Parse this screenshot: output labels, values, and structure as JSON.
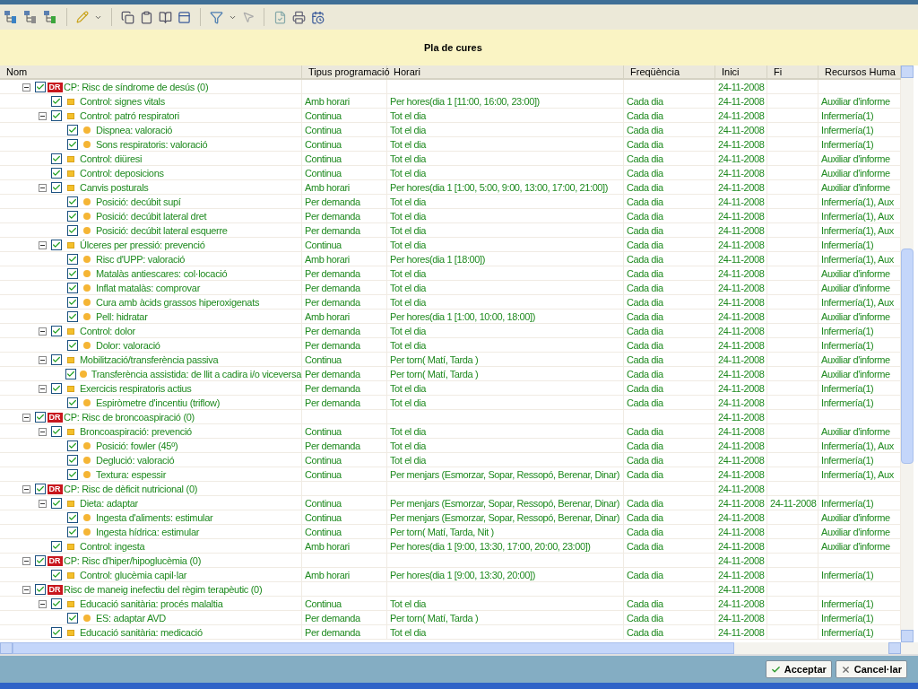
{
  "banner": {
    "title": "Pla de cures"
  },
  "table": {
    "columns": [
      "Nom",
      "Tipus programació",
      "Horari",
      "Freqüència",
      "Inici",
      "Fi",
      "Recursos Huma"
    ],
    "rows": [
      {
        "kind": "diagnosis",
        "badge": "DR",
        "name": "CP: Risc de síndrome de desús (0)",
        "checked": true,
        "expanded": true,
        "start": "24-11-2008",
        "children": [
          {
            "kind": "activity",
            "name": "Control: signes vitals",
            "checked": true,
            "schedule_type": "Amb horari",
            "schedule": "Per hores(dia 1 [11:00, 16:00, 23:00])",
            "frequency": "Cada dia",
            "start": "24-11-2008",
            "resources": "Auxiliar d'informe"
          },
          {
            "kind": "activity",
            "name": "Control: patró respiratori",
            "checked": true,
            "expanded": true,
            "schedule_type": "Continua",
            "schedule": "Tot el dia",
            "frequency": "Cada dia",
            "start": "24-11-2008",
            "resources": "Infermería(1)",
            "children": [
              {
                "kind": "task",
                "name": "Dispnea: valoració",
                "checked": true,
                "schedule_type": "Continua",
                "schedule": "Tot el dia",
                "frequency": "Cada dia",
                "start": "24-11-2008",
                "resources": "Infermería(1)"
              },
              {
                "kind": "task",
                "name": "Sons respiratoris: valoració",
                "checked": true,
                "schedule_type": "Continua",
                "schedule": "Tot el dia",
                "frequency": "Cada dia",
                "start": "24-11-2008",
                "resources": "Infermería(1)"
              }
            ]
          },
          {
            "kind": "activity",
            "name": "Control: diüresi",
            "checked": true,
            "schedule_type": "Continua",
            "schedule": "Tot el dia",
            "frequency": "Cada dia",
            "start": "24-11-2008",
            "resources": "Auxiliar d'informe"
          },
          {
            "kind": "activity",
            "name": "Control: deposicions",
            "checked": true,
            "schedule_type": "Continua",
            "schedule": "Tot el dia",
            "frequency": "Cada dia",
            "start": "24-11-2008",
            "resources": "Auxiliar d'informe"
          },
          {
            "kind": "activity",
            "name": "Canvis posturals",
            "checked": true,
            "expanded": true,
            "schedule_type": "Amb horari",
            "schedule": "Per hores(dia 1 [1:00, 5:00, 9:00, 13:00, 17:00, 21:00])",
            "frequency": "Cada dia",
            "start": "24-11-2008",
            "resources": "Auxiliar d'informe",
            "children": [
              {
                "kind": "task",
                "name": "Posició: decúbit supí",
                "checked": true,
                "schedule_type": "Per demanda",
                "schedule": "Tot el dia",
                "frequency": "Cada dia",
                "start": "24-11-2008",
                "resources": "Infermería(1), Aux"
              },
              {
                "kind": "task",
                "name": "Posició: decúbit lateral dret",
                "checked": true,
                "schedule_type": "Per demanda",
                "schedule": "Tot el dia",
                "frequency": "Cada dia",
                "start": "24-11-2008",
                "resources": "Infermería(1), Aux"
              },
              {
                "kind": "task",
                "name": "Posició: decúbit lateral esquerre",
                "checked": true,
                "schedule_type": "Per demanda",
                "schedule": "Tot el dia",
                "frequency": "Cada dia",
                "start": "24-11-2008",
                "resources": "Infermería(1), Aux"
              }
            ]
          },
          {
            "kind": "activity",
            "name": "Úlceres per pressió: prevenció",
            "checked": true,
            "expanded": true,
            "schedule_type": "Continua",
            "schedule": "Tot el dia",
            "frequency": "Cada dia",
            "start": "24-11-2008",
            "resources": "Infermería(1)",
            "children": [
              {
                "kind": "task",
                "name": "Risc d'UPP: valoració",
                "checked": true,
                "schedule_type": "Amb horari",
                "schedule": "Per hores(dia 1 [18:00])",
                "frequency": "Cada dia",
                "start": "24-11-2008",
                "resources": "Infermería(1), Aux"
              },
              {
                "kind": "task",
                "name": "Matalàs antiescares: col·locació",
                "checked": true,
                "schedule_type": "Per demanda",
                "schedule": "Tot el dia",
                "frequency": "Cada dia",
                "start": "24-11-2008",
                "resources": "Auxiliar d'informe"
              },
              {
                "kind": "task",
                "name": "Inflat matalàs: comprovar",
                "checked": true,
                "schedule_type": "Per demanda",
                "schedule": "Tot el dia",
                "frequency": "Cada dia",
                "start": "24-11-2008",
                "resources": "Auxiliar d'informe"
              },
              {
                "kind": "task",
                "name": "Cura amb àcids grassos hiperoxigenats",
                "checked": true,
                "schedule_type": "Per demanda",
                "schedule": "Tot el dia",
                "frequency": "Cada dia",
                "start": "24-11-2008",
                "resources": "Infermería(1), Aux"
              },
              {
                "kind": "task",
                "name": "Pell: hidratar",
                "checked": true,
                "schedule_type": "Amb horari",
                "schedule": "Per hores(dia 1 [1:00, 10:00, 18:00])",
                "frequency": "Cada dia",
                "start": "24-11-2008",
                "resources": "Auxiliar d'informe"
              }
            ]
          },
          {
            "kind": "activity",
            "name": "Control: dolor",
            "checked": true,
            "expanded": true,
            "schedule_type": "Per demanda",
            "schedule": "Tot el dia",
            "frequency": "Cada dia",
            "start": "24-11-2008",
            "resources": "Infermería(1)",
            "children": [
              {
                "kind": "task",
                "name": "Dolor: valoració",
                "checked": true,
                "schedule_type": "Per demanda",
                "schedule": "Tot el dia",
                "frequency": "Cada dia",
                "start": "24-11-2008",
                "resources": "Infermería(1)"
              }
            ]
          },
          {
            "kind": "activity",
            "name": "Mobilització/transferència passiva",
            "checked": true,
            "expanded": true,
            "schedule_type": "Continua",
            "schedule": "Per torn( Matí, Tarda )",
            "frequency": "Cada dia",
            "start": "24-11-2008",
            "resources": "Auxiliar d'informe",
            "children": [
              {
                "kind": "task",
                "name": "Transferència assistida: de llit a cadira i/o viceversa",
                "checked": true,
                "schedule_type": "Per demanda",
                "schedule": "Per torn( Matí, Tarda )",
                "frequency": "Cada dia",
                "start": "24-11-2008",
                "resources": "Auxiliar d'informe"
              }
            ]
          },
          {
            "kind": "activity",
            "name": "Exercicis respiratoris actius",
            "checked": true,
            "expanded": true,
            "schedule_type": "Per demanda",
            "schedule": "Tot el dia",
            "frequency": "Cada dia",
            "start": "24-11-2008",
            "resources": "Infermería(1)",
            "children": [
              {
                "kind": "task",
                "name": "Espiròmetre d'incentiu (triflow)",
                "checked": true,
                "schedule_type": "Per demanda",
                "schedule": "Tot el dia",
                "frequency": "Cada dia",
                "start": "24-11-2008",
                "resources": "Infermería(1)"
              }
            ]
          }
        ]
      },
      {
        "kind": "diagnosis",
        "badge": "DR",
        "name": "CP: Risc de broncoaspiració (0)",
        "checked": true,
        "expanded": true,
        "start": "24-11-2008",
        "children": [
          {
            "kind": "activity",
            "name": "Broncoaspiració: prevenció",
            "checked": true,
            "expanded": true,
            "schedule_type": "Continua",
            "schedule": "Tot el dia",
            "frequency": "Cada dia",
            "start": "24-11-2008",
            "resources": "Auxiliar d'informe",
            "children": [
              {
                "kind": "task",
                "name": "Posició: fowler (45º)",
                "checked": true,
                "schedule_type": "Per demanda",
                "schedule": "Tot el dia",
                "frequency": "Cada dia",
                "start": "24-11-2008",
                "resources": "Infermería(1), Aux"
              },
              {
                "kind": "task",
                "name": "Deglució: valoració",
                "checked": true,
                "schedule_type": "Continua",
                "schedule": "Tot el dia",
                "frequency": "Cada dia",
                "start": "24-11-2008",
                "resources": "Infermería(1)"
              },
              {
                "kind": "task",
                "name": "Textura: espessir",
                "checked": true,
                "schedule_type": "Continua",
                "schedule": "Per menjars (Esmorzar, Sopar, Ressopó, Berenar, Dinar)",
                "frequency": "Cada dia",
                "start": "24-11-2008",
                "resources": "Infermería(1), Aux"
              }
            ]
          }
        ]
      },
      {
        "kind": "diagnosis",
        "badge": "DR",
        "name": "CP: Risc de dèficit nutricional (0)",
        "checked": true,
        "expanded": true,
        "start": "24-11-2008",
        "children": [
          {
            "kind": "activity",
            "name": "Dieta: adaptar",
            "checked": true,
            "expanded": true,
            "schedule_type": "Continua",
            "schedule": "Per menjars (Esmorzar, Sopar, Ressopó, Berenar, Dinar)",
            "frequency": "Cada dia",
            "start": "24-11-2008",
            "end": "24-11-2008",
            "resources": "Infermería(1)",
            "children": [
              {
                "kind": "task",
                "name": "Ingesta d'aliments: estimular",
                "checked": true,
                "schedule_type": "Continua",
                "schedule": "Per menjars (Esmorzar, Sopar, Ressopó, Berenar, Dinar)",
                "frequency": "Cada dia",
                "start": "24-11-2008",
                "resources": "Auxiliar d'informe"
              },
              {
                "kind": "task",
                "name": "Ingesta hídrica: estimular",
                "checked": true,
                "schedule_type": "Continua",
                "schedule": "Per torn( Matí, Tarda, Nit )",
                "frequency": "Cada dia",
                "start": "24-11-2008",
                "resources": "Auxiliar d'informe"
              }
            ]
          },
          {
            "kind": "activity",
            "name": "Control: ingesta",
            "checked": true,
            "schedule_type": "Amb horari",
            "schedule": "Per hores(dia 1 [9:00, 13:30, 17:00, 20:00, 23:00])",
            "frequency": "Cada dia",
            "start": "24-11-2008",
            "resources": "Auxiliar d'informe"
          }
        ]
      },
      {
        "kind": "diagnosis",
        "badge": "DR",
        "name": "CP: Risc d'hiper/hipoglucèmia (0)",
        "checked": true,
        "expanded": true,
        "start": "24-11-2008",
        "children": [
          {
            "kind": "activity",
            "name": "Control: glucèmia capil·lar",
            "checked": true,
            "schedule_type": "Amb horari",
            "schedule": "Per hores(dia 1 [9:00, 13:30, 20:00])",
            "frequency": "Cada dia",
            "start": "24-11-2008",
            "resources": "Infermería(1)"
          }
        ]
      },
      {
        "kind": "diagnosis",
        "badge": "DR",
        "name": "Risc de maneig inefectiu del règim terapèutic (0)",
        "checked": true,
        "expanded": true,
        "start": "24-11-2008",
        "children": [
          {
            "kind": "activity",
            "name": "Educació sanitària: procés malaltia",
            "checked": true,
            "expanded": true,
            "schedule_type": "Continua",
            "schedule": "Tot el dia",
            "frequency": "Cada dia",
            "start": "24-11-2008",
            "resources": "Infermería(1)",
            "children": [
              {
                "kind": "task",
                "name": "ES: adaptar AVD",
                "checked": true,
                "schedule_type": "Per demanda",
                "schedule": "Per torn( Matí, Tarda )",
                "frequency": "Cada dia",
                "start": "24-11-2008",
                "resources": "Infermería(1)"
              }
            ]
          },
          {
            "kind": "activity",
            "name": "Educació sanitària: medicació",
            "checked": true,
            "schedule_type": "Per demanda",
            "schedule": "Tot el dia",
            "frequency": "Cada dia",
            "start": "24-11-2008",
            "resources": "Infermería(1)"
          }
        ]
      }
    ]
  },
  "buttons": [
    {
      "kind": "accept",
      "label": "Acceptar"
    },
    {
      "kind": "cancel",
      "label": "Cancel·lar"
    }
  ]
}
